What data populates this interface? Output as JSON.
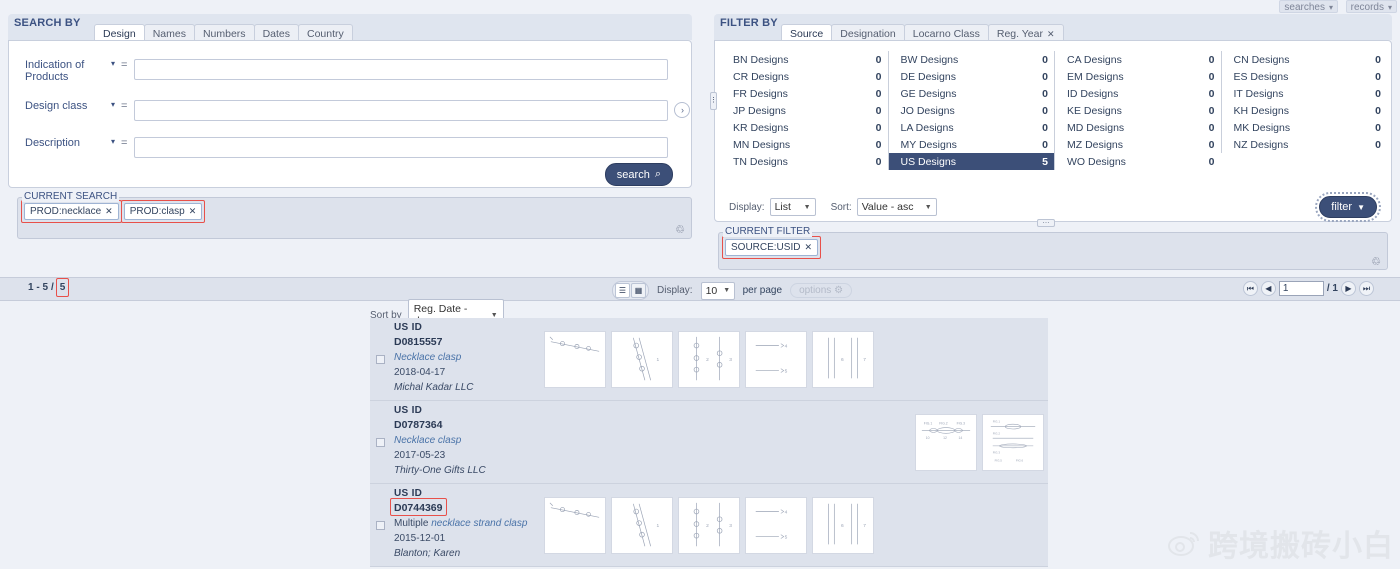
{
  "topbar": {
    "searches": "searches",
    "records": "records",
    "caret": "▾"
  },
  "search_panel": {
    "title": "SEARCH BY",
    "tabs": [
      {
        "label": "Design",
        "active": true
      },
      {
        "label": "Names",
        "active": false
      },
      {
        "label": "Numbers",
        "active": false
      },
      {
        "label": "Dates",
        "active": false
      },
      {
        "label": "Country",
        "active": false
      }
    ],
    "fields": [
      {
        "label": "Indication of Products",
        "operator": "=",
        "value": "",
        "caret": "▾"
      },
      {
        "label": "Design class",
        "operator": "=",
        "value": "",
        "caret": "▾",
        "has_lookup": true,
        "lookup_icon": "chevron-right-icon"
      },
      {
        "label": "Description",
        "operator": "=",
        "value": "",
        "caret": "▾"
      }
    ],
    "search_button": "search",
    "search_icon": "⌕"
  },
  "current_search": {
    "label": "CURRENT SEARCH",
    "chips": [
      {
        "text": "PROD:necklace",
        "close": "✕",
        "annotated": true
      },
      {
        "text": "PROD:clasp",
        "close": "✕",
        "annotated": true
      }
    ],
    "trash_icon": "♲"
  },
  "filter_panel": {
    "title": "FILTER BY",
    "tabs": [
      {
        "label": "Source",
        "active": true,
        "closable": false
      },
      {
        "label": "Designation",
        "active": false,
        "closable": false
      },
      {
        "label": "Locarno Class",
        "active": false,
        "closable": false
      },
      {
        "label": "Reg. Year",
        "active": false,
        "closable": true,
        "close": "✕"
      }
    ],
    "grid": [
      [
        {
          "label": "BN Designs",
          "value": "0",
          "selected": false
        },
        {
          "label": "BW Designs",
          "value": "0",
          "selected": false
        },
        {
          "label": "CA Designs",
          "value": "0",
          "selected": false
        },
        {
          "label": "CN Designs",
          "value": "0",
          "selected": false
        }
      ],
      [
        {
          "label": "CR Designs",
          "value": "0",
          "selected": false
        },
        {
          "label": "DE Designs",
          "value": "0",
          "selected": false
        },
        {
          "label": "EM Designs",
          "value": "0",
          "selected": false
        },
        {
          "label": "ES Designs",
          "value": "0",
          "selected": false
        }
      ],
      [
        {
          "label": "FR Designs",
          "value": "0",
          "selected": false
        },
        {
          "label": "GE Designs",
          "value": "0",
          "selected": false
        },
        {
          "label": "ID Designs",
          "value": "0",
          "selected": false
        },
        {
          "label": "IT Designs",
          "value": "0",
          "selected": false
        }
      ],
      [
        {
          "label": "JP Designs",
          "value": "0",
          "selected": false
        },
        {
          "label": "JO Designs",
          "value": "0",
          "selected": false
        },
        {
          "label": "KE Designs",
          "value": "0",
          "selected": false
        },
        {
          "label": "KH Designs",
          "value": "0",
          "selected": false
        }
      ],
      [
        {
          "label": "KR Designs",
          "value": "0",
          "selected": false
        },
        {
          "label": "LA Designs",
          "value": "0",
          "selected": false
        },
        {
          "label": "MD Designs",
          "value": "0",
          "selected": false
        },
        {
          "label": "MK Designs",
          "value": "0",
          "selected": false
        }
      ],
      [
        {
          "label": "MN Designs",
          "value": "0",
          "selected": false
        },
        {
          "label": "MY Designs",
          "value": "0",
          "selected": false
        },
        {
          "label": "MZ Designs",
          "value": "0",
          "selected": false
        },
        {
          "label": "NZ Designs",
          "value": "0",
          "selected": false
        }
      ],
      [
        {
          "label": "TN Designs",
          "value": "0",
          "selected": false
        },
        {
          "label": "US Designs",
          "value": "5",
          "selected": true
        },
        {
          "label": "WO Designs",
          "value": "0",
          "selected": false
        },
        {
          "label": "",
          "value": "",
          "selected": false
        }
      ]
    ],
    "display_label": "Display:",
    "display_value": "List",
    "sort_label": "Sort:",
    "sort_value": "Value - asc",
    "filter_button": "filter",
    "filter_icon": "▼"
  },
  "current_filter": {
    "label": "CURRENT FILTER",
    "chips": [
      {
        "text": "SOURCE:USID",
        "close": "✕",
        "annotated": true
      }
    ],
    "trash_icon": "♲"
  },
  "results_bar": {
    "range": "1 - 5",
    "separator": "/",
    "total": "5",
    "view_list_icon": "list-view-icon",
    "view_grid_icon": "grid-view-icon",
    "display_label": "Display:",
    "per_page_value": "10",
    "per_page_label": "per page",
    "options_label": "options",
    "options_icon": "⚙",
    "pagination": {
      "first": "⏮",
      "prev": "◀",
      "page_value": "1",
      "page_total": "/ 1",
      "next": "▶",
      "last": "⏭"
    }
  },
  "sort_by": {
    "label": "Sort by",
    "value": "Reg. Date - desc",
    "caret": "▾"
  },
  "results": [
    {
      "source": "US ID",
      "number": "D0815557",
      "title_plain": "",
      "title": "Necklace clasp",
      "date": "2018-04-17",
      "owner": "Michal Kadar LLC",
      "annotated_number": false,
      "thumb_count": 5,
      "thumbs_align": "left"
    },
    {
      "source": "US ID",
      "number": "D0787364",
      "title_plain": "",
      "title": "Necklace clasp",
      "date": "2017-05-23",
      "owner": "Thirty-One Gifts LLC",
      "annotated_number": false,
      "thumb_count": 2,
      "thumbs_align": "right"
    },
    {
      "source": "US ID",
      "number": "D0744369",
      "title_plain": "Multiple ",
      "title": "necklace strand clasp",
      "date": "2015-12-01",
      "owner": "Blanton; Karen",
      "annotated_number": true,
      "thumb_count": 5,
      "thumbs_align": "left"
    }
  ],
  "watermark": {
    "text": "跨境搬砖小白",
    "icon": "weibo-icon"
  },
  "colors": {
    "accent": "#3c4f78",
    "page_bg": "#eef1f7",
    "panel_header": "#dfe5ef",
    "row_bg": "#dde2ec",
    "annotation": "#e8504a",
    "link": "#4a73a8"
  }
}
